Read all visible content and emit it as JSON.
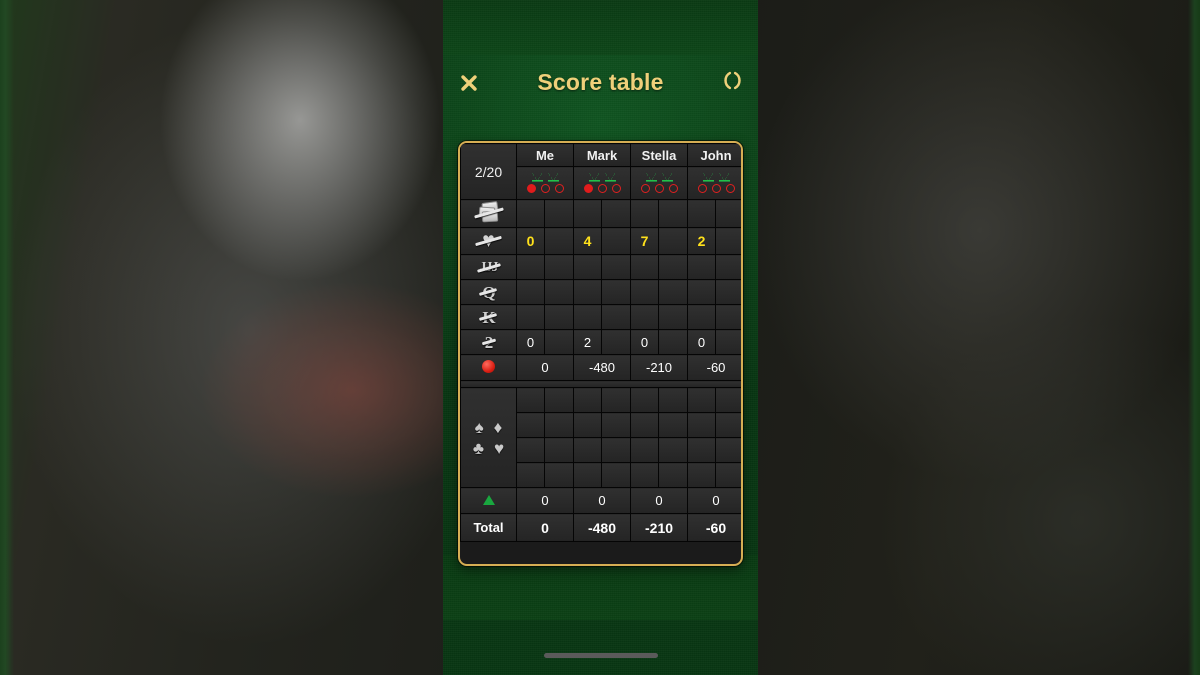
{
  "app": {
    "header": {
      "title": "Score table",
      "close_icon": "close-x-icon",
      "rotate_icon": "rotate-orientation-icon"
    },
    "accent_gold": "#d6ae54",
    "title_color": "#efd07a",
    "felt_green": "#0c4517"
  },
  "table": {
    "round_counter": "2/20",
    "players": [
      {
        "name": "Me",
        "triangles": 2,
        "circles_filled": 1,
        "circles_total": 3
      },
      {
        "name": "Mark",
        "triangles": 2,
        "circles_filled": 1,
        "circles_total": 3
      },
      {
        "name": "Stella",
        "triangles": 2,
        "circles_filled": 0,
        "circles_total": 3
      },
      {
        "name": "John",
        "triangles": 2,
        "circles_filled": 0,
        "circles_total": 3
      }
    ],
    "contract_rows": [
      {
        "icon": "no-tricks-icon",
        "values": [
          "",
          "",
          "",
          ""
        ]
      },
      {
        "icon": "no-hearts-icon",
        "values": [
          "0",
          "4",
          "7",
          "2"
        ],
        "highlight": true
      },
      {
        "icon": "no-jacks-icon",
        "values": [
          "",
          "",
          "",
          ""
        ]
      },
      {
        "icon": "no-queens-icon",
        "values": [
          "",
          "",
          "",
          ""
        ]
      },
      {
        "icon": "no-king-icon",
        "values": [
          "",
          "",
          "",
          ""
        ]
      },
      {
        "icon": "no-last-two-icon",
        "values": [
          "0",
          "2",
          "0",
          "0"
        ]
      }
    ],
    "negative_subtotal": {
      "icon": "red-dot-icon",
      "values": [
        "0",
        "-480",
        "-210",
        "-60"
      ]
    },
    "positive_rows": [
      {
        "icon": "",
        "values": [
          "",
          "",
          "",
          ""
        ]
      },
      {
        "icon": "suits-spade-diamond-icon",
        "values": [
          "",
          "",
          "",
          ""
        ]
      },
      {
        "icon": "suits-club-heart-icon",
        "values": [
          "",
          "",
          "",
          ""
        ]
      },
      {
        "icon": "",
        "values": [
          "",
          "",
          "",
          ""
        ]
      }
    ],
    "positive_subtotal": {
      "icon": "green-triangle-icon",
      "values": [
        "0",
        "0",
        "0",
        "0"
      ]
    },
    "total_row": {
      "label": "Total",
      "values": [
        "0",
        "-480",
        "-210",
        "-60"
      ]
    }
  },
  "system": {
    "home_indicator": "home-indicator"
  }
}
